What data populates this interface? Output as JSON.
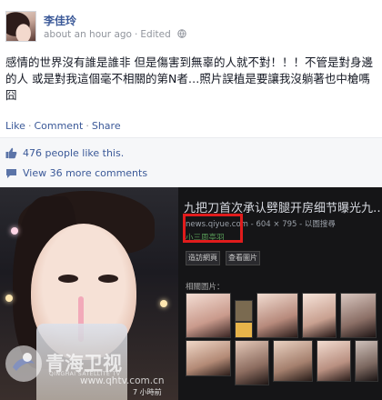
{
  "post": {
    "author": "李佳玲",
    "timestamp": "about an hour ago",
    "separator": "·",
    "edited": "Edited",
    "globe_icon": "globe-icon",
    "text": "感情的世界沒有誰是誰非 但是傷害到無辜的人就不對！！！不管是對身邊的人 或是對我這個毫不相關的第N者…照片誤植是要讓我沒躺著也中槍嗎 囧",
    "actions": {
      "like": "Like",
      "comment": "Comment",
      "share": "Share",
      "sep": "·"
    },
    "likes": "476 people like this.",
    "comments": "View 36 more comments",
    "like_icon": "thumbs-up-icon",
    "comment_icon": "speech-bubble-icon"
  },
  "search_result": {
    "title": "九把刀首次承认劈腿开房细节曝光九…",
    "source": "news.qiyue.com",
    "size_info": "- 604 × 795 - 以圖搜尋",
    "source_name": "小三周亭羽",
    "buttons": [
      "造訪網頁",
      "查看圖片"
    ],
    "related_label": "相關圖片："
  },
  "watermark": {
    "title": "青海卫视",
    "subtitle": "QINGHAI SATELLITE TV",
    "url": "www.qhtv.com.cn",
    "time": "7 小時前"
  },
  "colors": {
    "link": "#3b5998",
    "meta": "#90949c",
    "highlight_box": "#e01c1c"
  }
}
